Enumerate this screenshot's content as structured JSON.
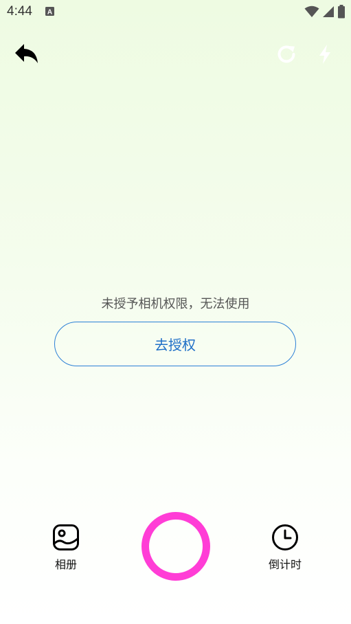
{
  "status_bar": {
    "time": "4:44",
    "notification_icon": "a-badge-icon",
    "icons": [
      "wifi-icon",
      "cellular-signal-icon",
      "battery-icon"
    ]
  },
  "top_bar": {
    "back_icon": "reply-back-icon",
    "rotate_icon": "rotate-camera-icon",
    "flash_icon": "flash-icon",
    "icon_color_light": "#ffffff"
  },
  "main": {
    "message": "未授予相机权限，无法使用",
    "auth_button_label": "去授权",
    "auth_button_color": "#2a7fd6"
  },
  "bottom_bar": {
    "album_label": "相册",
    "album_icon": "image-gallery-icon",
    "timer_label": "倒计时",
    "timer_icon": "clock-icon",
    "shutter_color": "#ff3dd6"
  }
}
